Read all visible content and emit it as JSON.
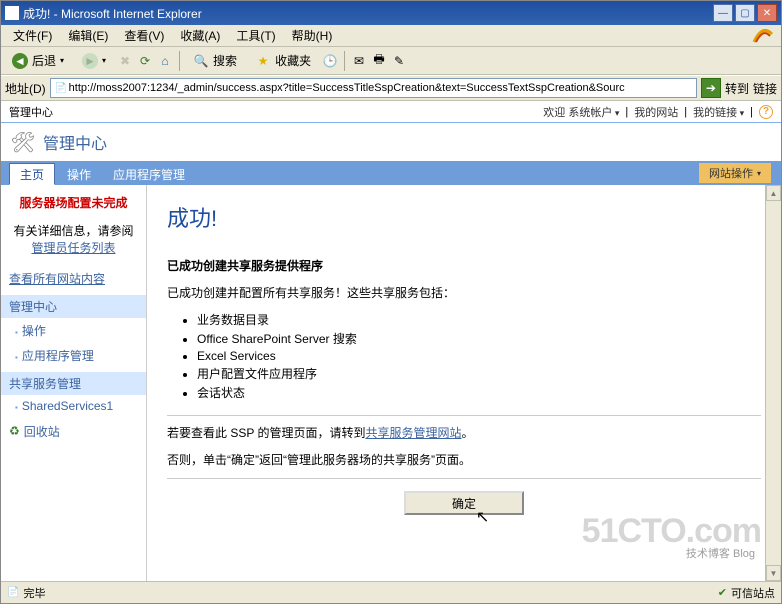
{
  "window": {
    "title": "成功! - Microsoft Internet Explorer"
  },
  "menus": [
    "文件(F)",
    "编辑(E)",
    "查看(V)",
    "收藏(A)",
    "工具(T)",
    "帮助(H)"
  ],
  "toolbar": {
    "back": "后退",
    "search": "搜索",
    "favorites": "收藏夹"
  },
  "address": {
    "label": "地址(D)",
    "url": "http://moss2007:1234/_admin/success.aspx?title=SuccessTitleSspCreation&text=SuccessTextSspCreation&Sourc",
    "go": "转到",
    "links": "链接"
  },
  "sp": {
    "crumb": "管理中心",
    "welcome": "欢迎 系统帐户",
    "mysite": "我的网站",
    "mylinks": "我的链接",
    "title": "管理中心",
    "tabs": [
      "主页",
      "操作",
      "应用程序管理"
    ],
    "site_actions": "网站操作"
  },
  "left": {
    "warn": "服务器场配置未完成",
    "warn_sub_pre": "有关详细信息，请参阅",
    "warn_sub_link": "管理员任务列表",
    "view_all": "查看所有网站内容",
    "sec1": "管理中心",
    "sec1_items": [
      "操作",
      "应用程序管理"
    ],
    "sec2": "共享服务管理",
    "sec2_items": [
      "SharedServices1"
    ],
    "recycle": "回收站"
  },
  "main": {
    "h1": "成功!",
    "h2": "已成功创建共享服务提供程序",
    "p1": "已成功创建并配置所有共享服务！这些共享服务包括：",
    "bullets": [
      "业务数据目录",
      "Office SharePoint Server 搜索",
      "Excel Services",
      "用户配置文件应用程序",
      "会话状态"
    ],
    "p2_pre": "若要查看此 SSP 的管理页面，请转到",
    "p2_link": "共享服务管理网站",
    "p2_suf": "。",
    "p3": "否则，单击“确定”返回“管理此服务器场的共享服务”页面。",
    "ok": "确定"
  },
  "status": {
    "done": "完毕",
    "zone": "可信站点"
  },
  "watermark": {
    "big": "51CTO.com",
    "sub": "技术博客      Blog"
  }
}
